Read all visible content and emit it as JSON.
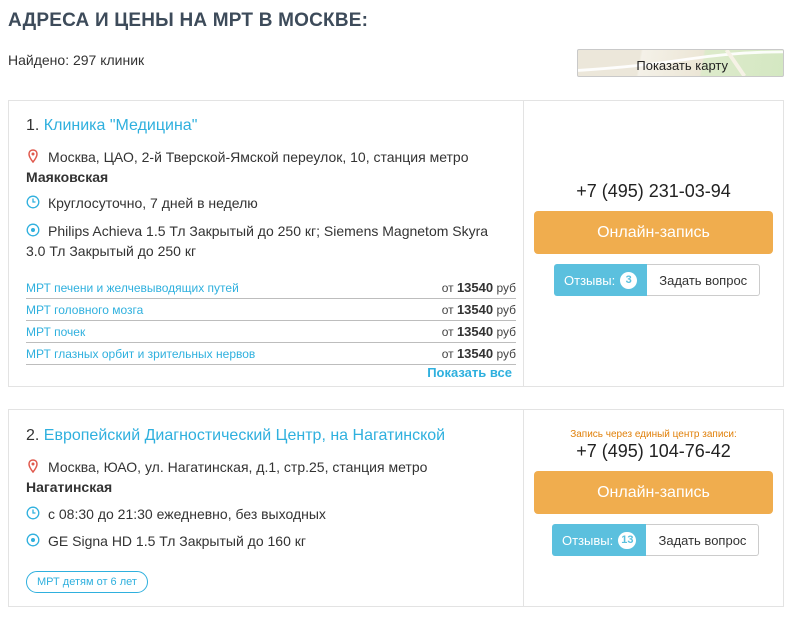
{
  "page": {
    "title": "АДРЕСА И ЦЕНЫ НА МРТ В МОСКВЕ:",
    "found": "Найдено: 297 клиник",
    "map_button": "Показать карту"
  },
  "clinics": [
    {
      "number": "1.",
      "name": "Клиника \"Медицина\"",
      "address": "Москва, ЦАО, 2-й Тверской-Ямской переулок, 10, станция метро",
      "metro": "Маяковская",
      "hours": "Круглосуточно, 7 дней в неделю",
      "equipment_line1": "Philips Achieva 1.5 Тл Закрытый до 250 кг; Siemens Magnetom Skyra",
      "equipment_line2": "3.0 Тл Закрытый до 250 кг",
      "prices": [
        {
          "service": "МРТ печени и желчевыводящих путей",
          "from": "от",
          "price": "13540",
          "currency": "руб"
        },
        {
          "service": "МРТ головного мозга",
          "from": "от",
          "price": "13540",
          "currency": "руб"
        },
        {
          "service": "МРТ почек",
          "from": "от",
          "price": "13540",
          "currency": "руб"
        },
        {
          "service": "МРТ глазных орбит и зрительных нервов",
          "from": "от",
          "price": "13540",
          "currency": "руб"
        }
      ],
      "show_all": "Показать все",
      "phone": "+7 (495) 231-03-94",
      "book_label": "Онлайн-запись",
      "reviews_label": "Отзывы:",
      "reviews_count": "3",
      "ask_label": "Задать вопрос"
    },
    {
      "number": "2.",
      "name": "Европейский Диагностический Центр, на Нагатинской",
      "address": "Москва, ЮАО, ул. Нагатинская, д.1, стр.25, станция метро",
      "metro": "Нагатинская",
      "hours": "с 08:30 до 21:30 ежедневно, без выходных",
      "equipment": "GE Signa HD 1.5 Тл Закрытый до 160 кг",
      "tag": "МРТ детям от 6 лет",
      "via_center": "Запись через единый центр записи:",
      "phone": "+7 (495) 104-76-42",
      "book_label": "Онлайн-запись",
      "reviews_label": "Отзывы:",
      "reviews_count": "13",
      "ask_label": "Задать вопрос"
    }
  ],
  "icons": {
    "address": "map-pin-icon",
    "hours": "clock-icon",
    "equipment": "target-icon"
  },
  "colors": {
    "link": "#2fb0de",
    "book_button": "#f0ad4e",
    "reviews_button": "#5bc0de",
    "title": "#3d4b5a",
    "pin": "#e05a4e",
    "via_text": "#e0800a"
  }
}
